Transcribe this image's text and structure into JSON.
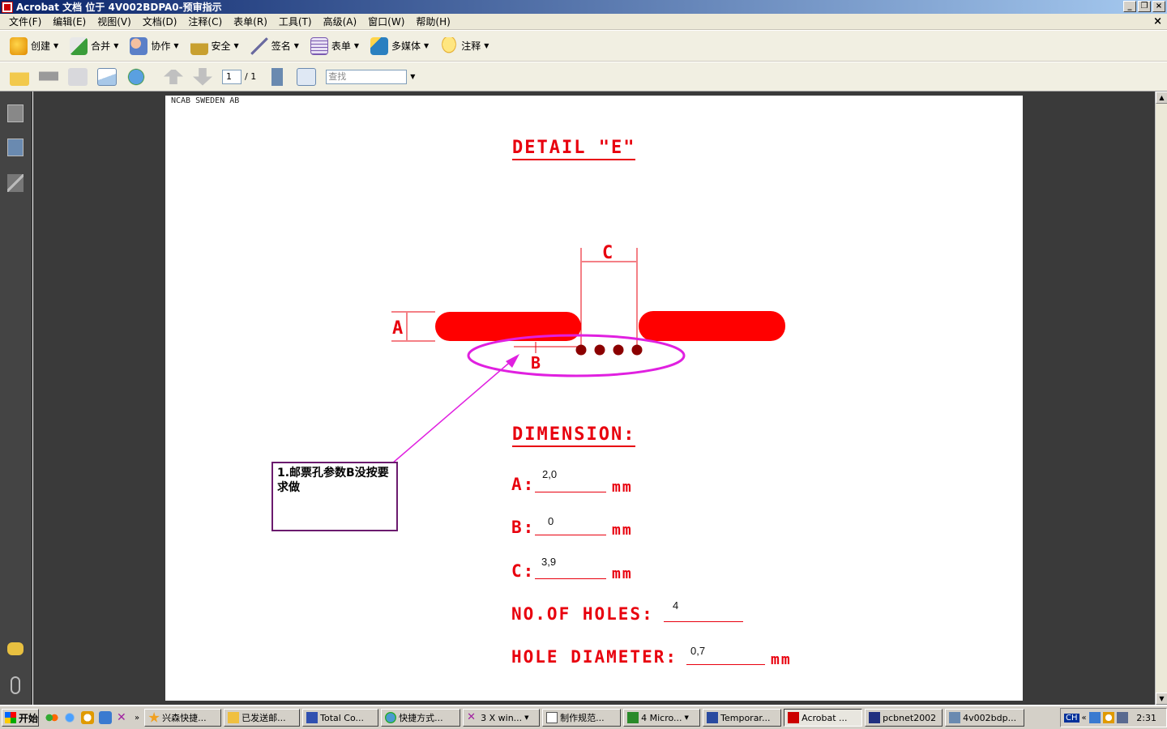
{
  "window": {
    "title": "Acrobat 文档 位于 4V002BDPA0-预审指示"
  },
  "menu": [
    "文件(F)",
    "编辑(E)",
    "视图(V)",
    "文档(D)",
    "注释(C)",
    "表单(R)",
    "工具(T)",
    "高级(A)",
    "窗口(W)",
    "帮助(H)"
  ],
  "toolbar1": [
    {
      "label": "创建",
      "icon": "create-icon",
      "color": "#f5a623"
    },
    {
      "label": "合并",
      "icon": "combine-icon",
      "color": "#3a9d3a"
    },
    {
      "label": "协作",
      "icon": "collaborate-icon",
      "color": "#5a7fc8"
    },
    {
      "label": "安全",
      "icon": "lock-icon",
      "color": "#c8a030"
    },
    {
      "label": "签名",
      "icon": "pen-icon",
      "color": "#6a6aa0"
    },
    {
      "label": "表单",
      "icon": "form-icon",
      "color": "#7a5ab0"
    },
    {
      "label": "多媒体",
      "icon": "multimedia-icon",
      "color": "#2a80c0"
    },
    {
      "label": "注释",
      "icon": "comment-icon",
      "color": "#f0c020"
    }
  ],
  "toolbar2": {
    "page_current": "1",
    "page_total": "/ 1",
    "find_placeholder": "查找"
  },
  "document": {
    "header": "NCAB SWEDEN AB",
    "detail_title": "DETAIL \"E\"",
    "dimension_title": "DIMENSION:",
    "dim_labels": {
      "a": "A",
      "b": "B",
      "c": "C"
    },
    "rows": [
      {
        "label": "A:",
        "value": "2,0",
        "unit": "mm"
      },
      {
        "label": "B:",
        "value": "0",
        "unit": "mm"
      },
      {
        "label": "C:",
        "value": "3,9",
        "unit": "mm"
      },
      {
        "label": "NO.OF HOLES:",
        "value": "4",
        "unit": ""
      },
      {
        "label": "HOLE DIAMETER:",
        "value": "0,7",
        "unit": "mm"
      }
    ],
    "callout": "1.邮票孔参数B没按要求做"
  },
  "taskbar": {
    "start": "开始",
    "tasks": [
      "兴森快捷...",
      "已发送邮...",
      "Total Co...",
      "快捷方式...",
      "3 X win...",
      "制作规范...",
      "4 Micro...",
      "Temporar...",
      "Acrobat ...",
      "pcbnet2002",
      "4v002bdp..."
    ],
    "clock": "2:31",
    "tray_label": "CH"
  },
  "colors": {
    "drawing_red": "#e8000e",
    "highlight_magenta": "#e020e0",
    "callout_border": "#6b1b6e"
  }
}
